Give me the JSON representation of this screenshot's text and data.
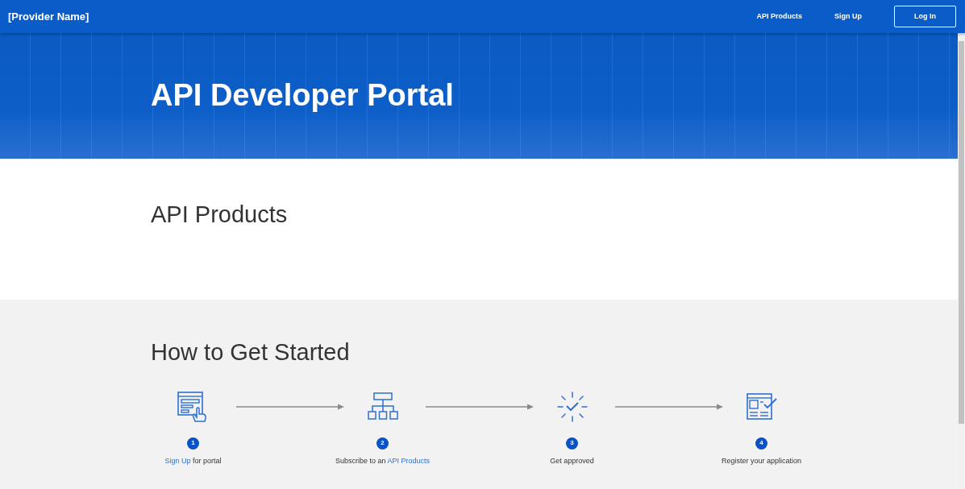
{
  "navbar": {
    "brand": "[Provider Name]",
    "links": [
      {
        "label": "API Products",
        "kind": "link"
      },
      {
        "label": "Sign Up",
        "kind": "link"
      },
      {
        "label": "Log In",
        "kind": "button"
      }
    ]
  },
  "hero": {
    "title": "API Developer Portal"
  },
  "products_section": {
    "title": "API Products"
  },
  "get_started": {
    "title": "How to Get Started",
    "steps": [
      {
        "number": "1",
        "parts": [
          {
            "text": "Sign Up",
            "link": true
          },
          {
            "text": " for portal",
            "link": false
          }
        ]
      },
      {
        "number": "2",
        "parts": [
          {
            "text": "Subscribe to an ",
            "link": false
          },
          {
            "text": "API Products",
            "link": true
          }
        ]
      },
      {
        "number": "3",
        "parts": [
          {
            "text": "Get approved",
            "link": false
          }
        ]
      },
      {
        "number": "4",
        "parts": [
          {
            "text": "Register your application",
            "link": false
          }
        ]
      }
    ]
  }
}
